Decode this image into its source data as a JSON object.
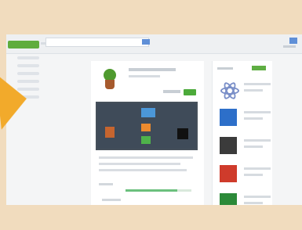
{
  "colors": {
    "frame_bg": "#f1dcbe",
    "browser_bg": "#f4f5f6",
    "accent_green": "#5fad3d",
    "accent_blue": "#5f8fd7",
    "arrow_orange": "#f2aa2b",
    "media_bg": "#3f4b59"
  },
  "icons": {
    "pointer_arrow": "pointer-arrow-icon",
    "app_icon": "plant-pot-icon",
    "side_icons": [
      "atom-icon",
      "blue-square-icon",
      "dark-square-icon",
      "red-square-icon",
      "green-square-icon"
    ]
  }
}
